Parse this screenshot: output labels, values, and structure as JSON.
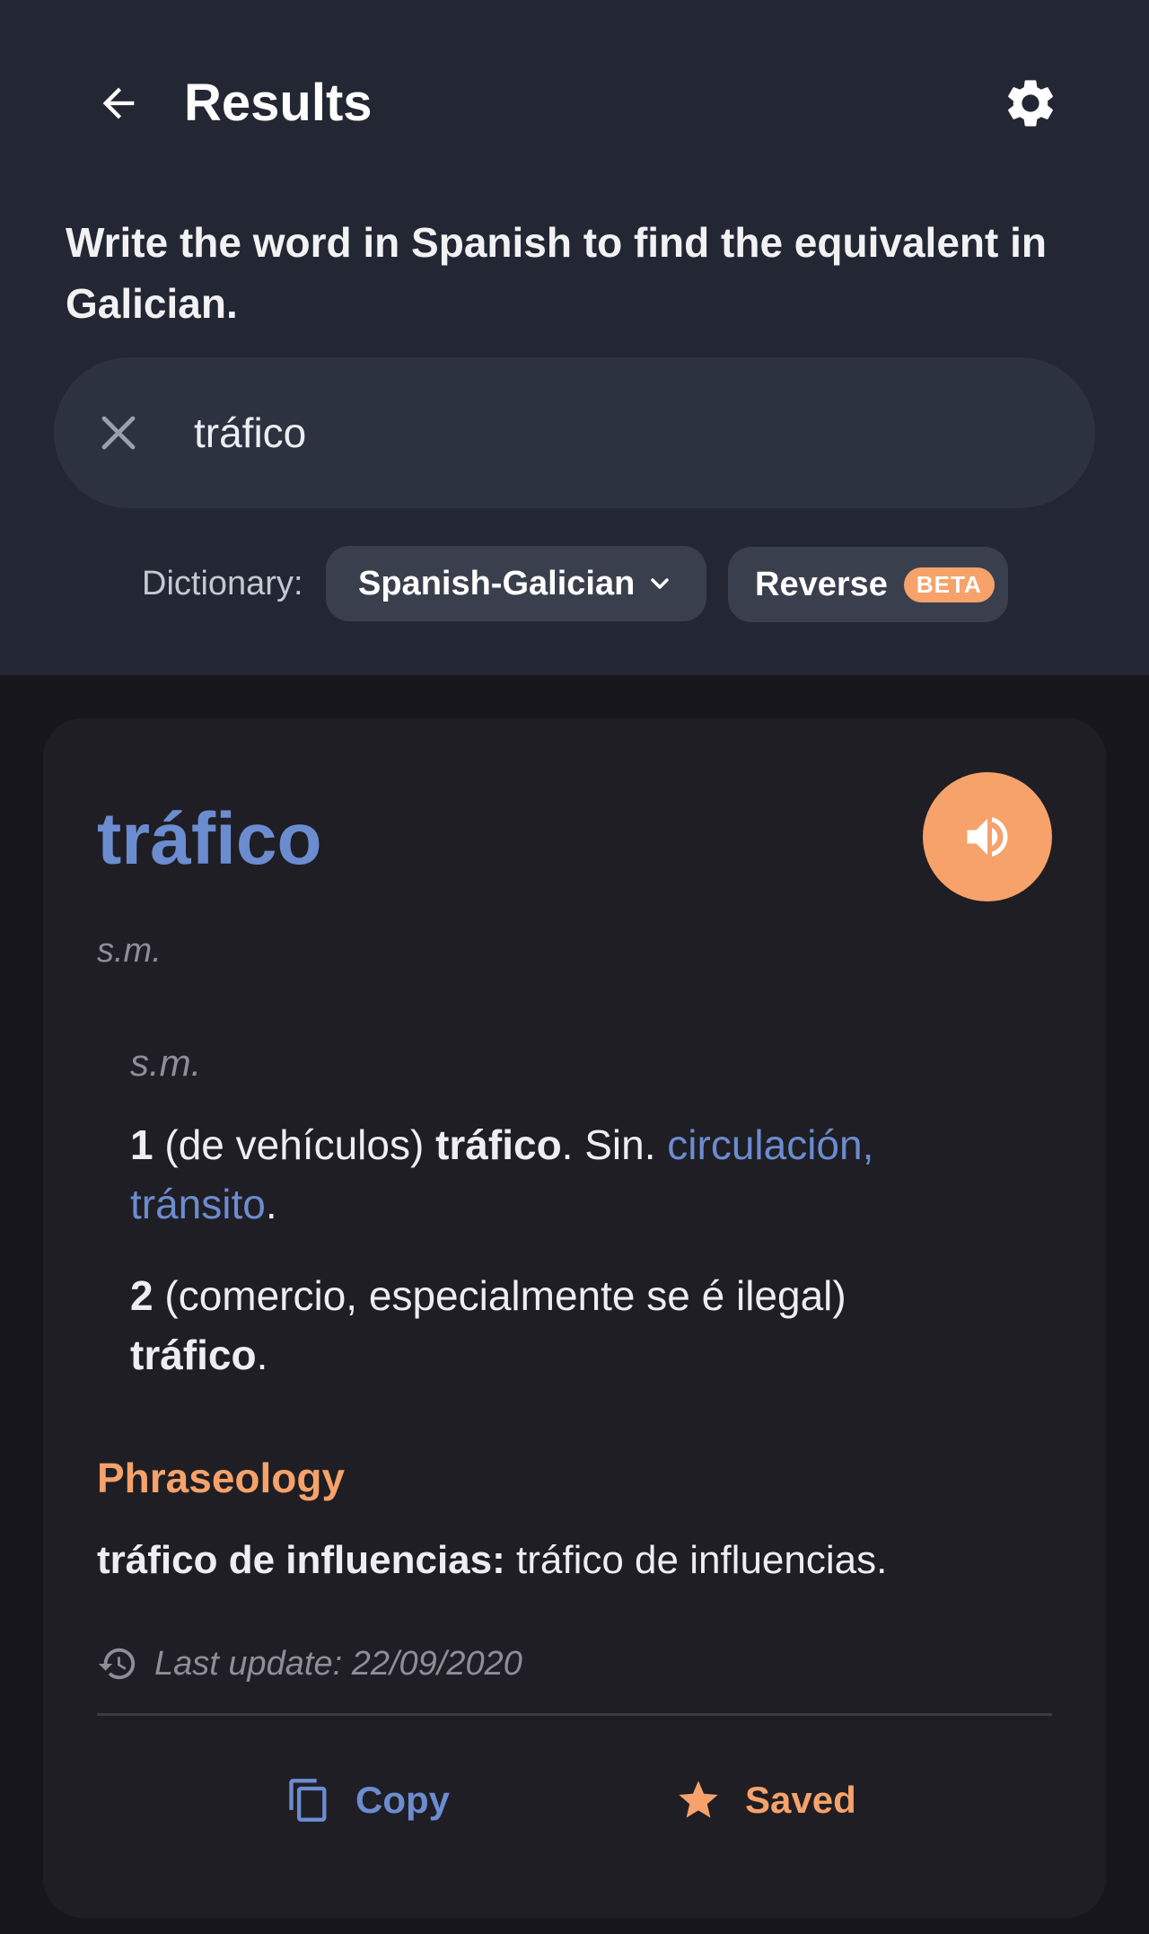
{
  "header": {
    "title": "Results",
    "instructions": "Write the word in Spanish to find the equivalent in Galician."
  },
  "search": {
    "value": "tráfico"
  },
  "dictionary": {
    "label": "Dictionary:",
    "selected": "Spanish-Galician",
    "reverse_label": "Reverse",
    "reverse_badge": "BETA"
  },
  "entry": {
    "headword": "tráfico",
    "pos": "s.m.",
    "group_pos": "s.m.",
    "senses": [
      {
        "number": "1",
        "context": " (de vehículos) ",
        "translation": "tráfico",
        "after_translation": ". Sin. ",
        "synonyms": "circulación, tránsito",
        "end": "."
      },
      {
        "number": "2",
        "context": " (comercio, especialmente se é ilegal) ",
        "translation": "tráfico",
        "end": "."
      }
    ],
    "phraseology": {
      "title": "Phraseology",
      "items": [
        {
          "phrase": "tráfico de influencias:",
          "translation": " tráfico de influencias."
        }
      ]
    },
    "last_update": "Last update: 22/09/2020"
  },
  "actions": {
    "copy_label": "Copy",
    "saved_label": "Saved"
  },
  "colors": {
    "accent_blue": "#6c8cd0",
    "accent_orange": "#f6a26a",
    "header_bg": "#232733",
    "card_bg": "#1f1e24"
  },
  "icons": [
    "arrow-left-icon",
    "gear-icon",
    "close-icon",
    "chevron-down-icon",
    "speaker-icon",
    "history-icon",
    "copy-icon",
    "star-icon"
  ]
}
